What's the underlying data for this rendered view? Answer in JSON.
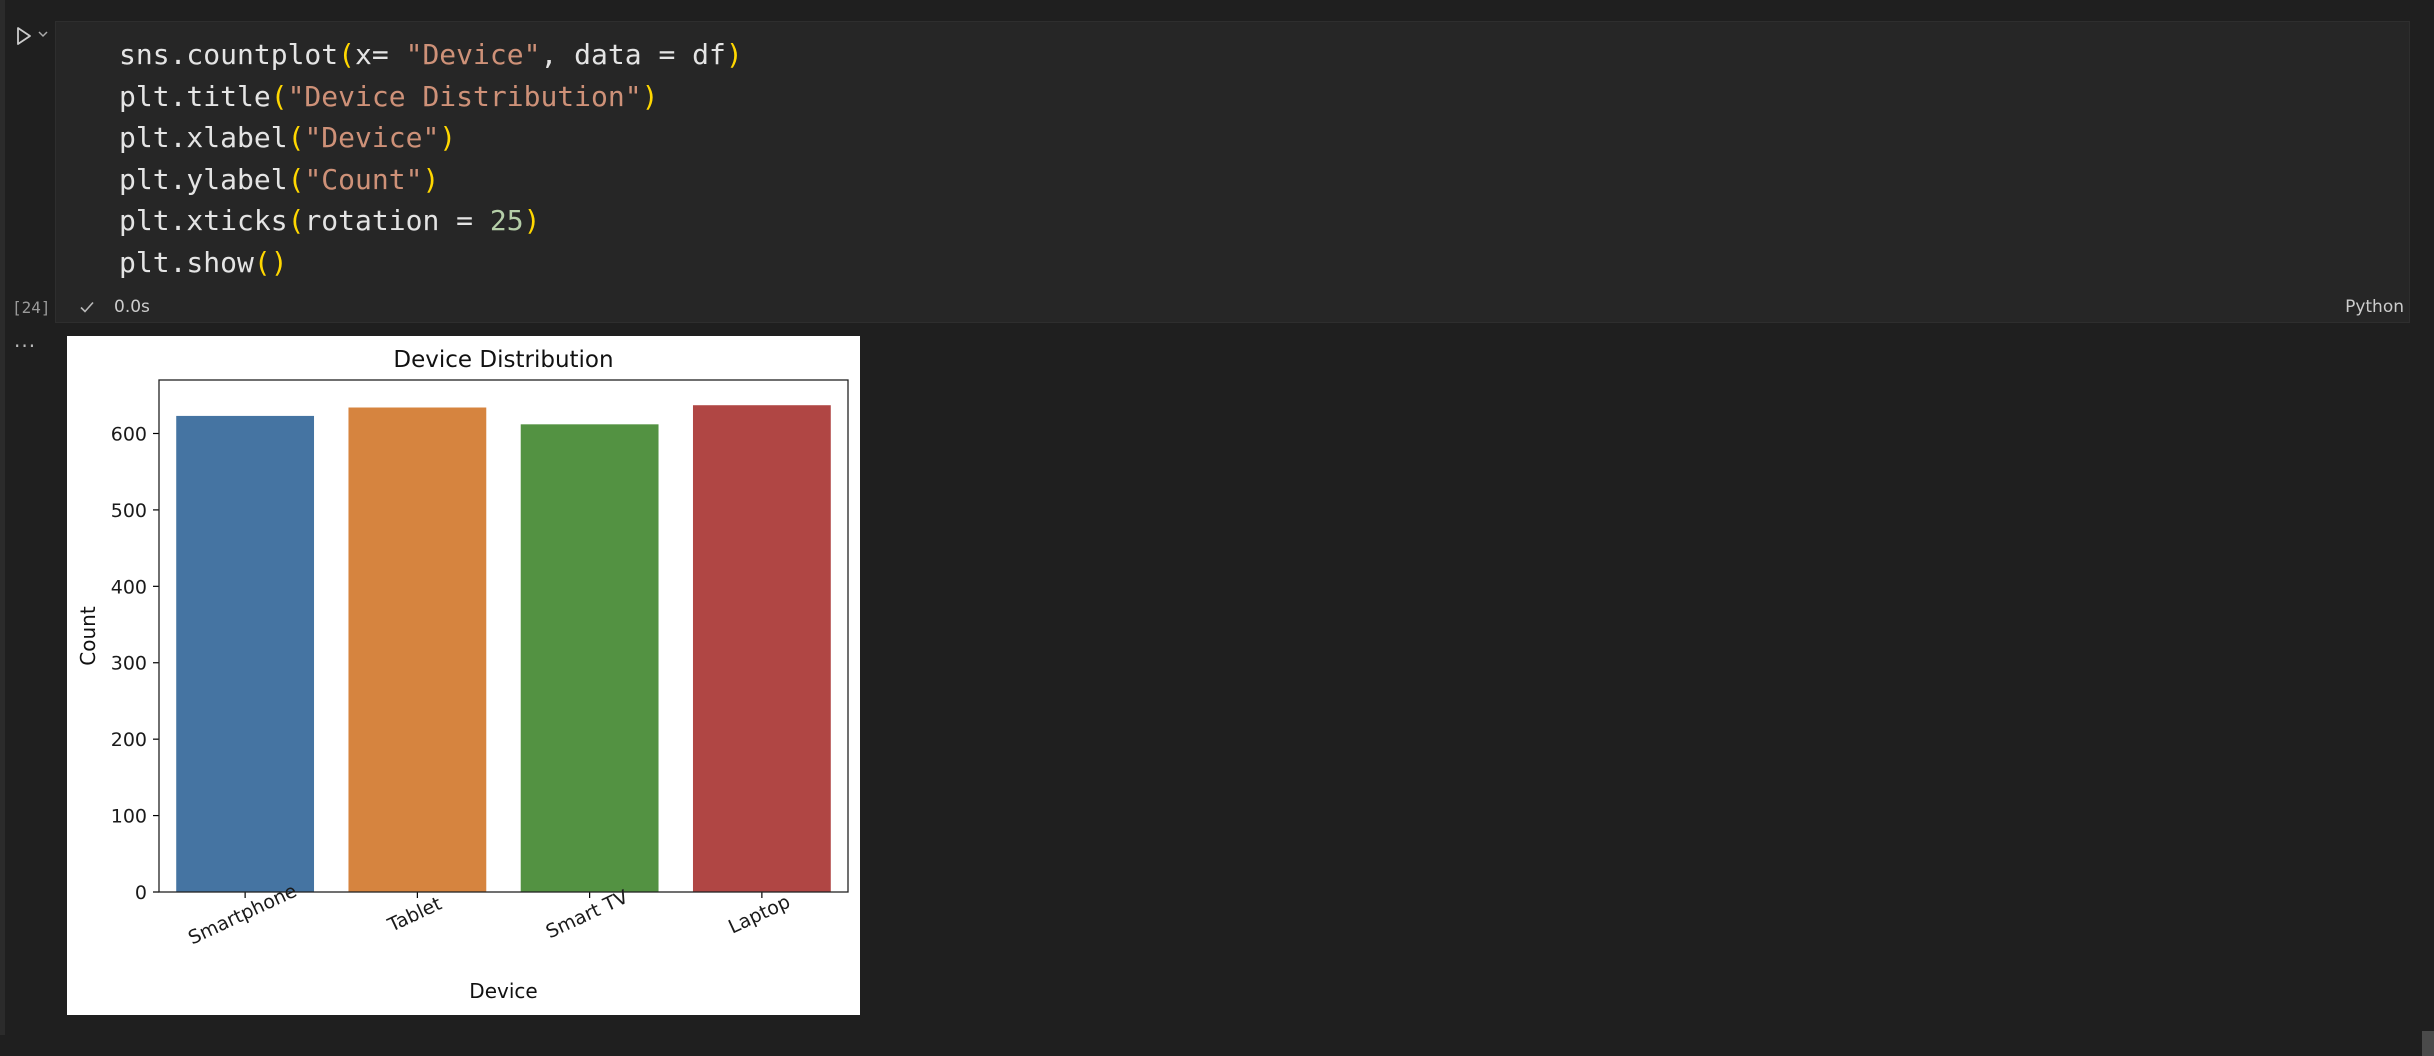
{
  "cell": {
    "execution_count": "[24]",
    "exec_time": "0.0s",
    "language": "Python",
    "output_menu": "···",
    "code_lines": [
      [
        {
          "t": "sns.countplot",
          "c": "plain"
        },
        {
          "t": "(",
          "c": "par"
        },
        {
          "t": "x= ",
          "c": "plain"
        },
        {
          "t": "\"Device\"",
          "c": "str"
        },
        {
          "t": ", data = df",
          "c": "plain"
        },
        {
          "t": ")",
          "c": "par"
        }
      ],
      [
        {
          "t": "plt.title",
          "c": "plain"
        },
        {
          "t": "(",
          "c": "par"
        },
        {
          "t": "\"Device Distribution\"",
          "c": "str"
        },
        {
          "t": ")",
          "c": "par"
        }
      ],
      [
        {
          "t": "plt.xlabel",
          "c": "plain"
        },
        {
          "t": "(",
          "c": "par"
        },
        {
          "t": "\"Device\"",
          "c": "str"
        },
        {
          "t": ")",
          "c": "par"
        }
      ],
      [
        {
          "t": "plt.ylabel",
          "c": "plain"
        },
        {
          "t": "(",
          "c": "par"
        },
        {
          "t": "\"Count\"",
          "c": "str"
        },
        {
          "t": ")",
          "c": "par"
        }
      ],
      [
        {
          "t": "plt.xticks",
          "c": "plain"
        },
        {
          "t": "(",
          "c": "par"
        },
        {
          "t": "rotation = ",
          "c": "plain"
        },
        {
          "t": "25",
          "c": "num"
        },
        {
          "t": ")",
          "c": "par"
        }
      ],
      [
        {
          "t": "plt.show",
          "c": "plain"
        },
        {
          "t": "(",
          "c": "par"
        },
        {
          "t": ")",
          "c": "par"
        }
      ]
    ]
  },
  "icons": {
    "run": "play-icon",
    "expand": "chevron-down-icon",
    "status": "check-icon"
  },
  "chart_data": {
    "type": "bar",
    "title": "Device Distribution",
    "xlabel": "Device",
    "ylabel": "Count",
    "categories": [
      "Smartphone",
      "Tablet",
      "Smart TV",
      "Laptop"
    ],
    "values": [
      623,
      634,
      612,
      637
    ],
    "colors": [
      "#4574a2",
      "#d6843f",
      "#539242",
      "#b04644"
    ],
    "ylim": [
      0,
      670
    ],
    "yticks": [
      0,
      100,
      200,
      300,
      400,
      500,
      600
    ],
    "xtick_rotation": 25,
    "grid": false
  }
}
